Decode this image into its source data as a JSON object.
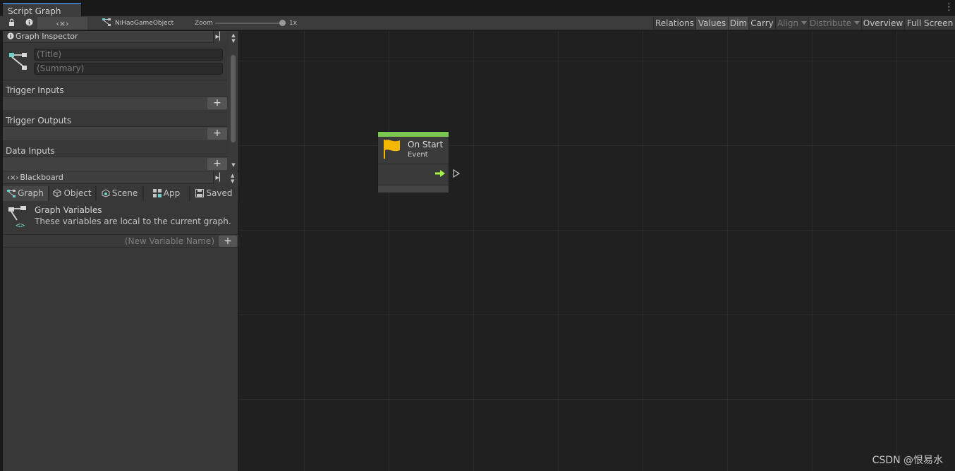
{
  "window": {
    "tab_title": "Script Graph"
  },
  "toolbar": {
    "breadcrumb": "NiHaoGameObject",
    "zoom_label": "Zoom",
    "zoom_value": "1x",
    "zoom_level": 1.0,
    "buttons": {
      "relations": "Relations",
      "values": "Values",
      "dim": "Dim",
      "carry": "Carry",
      "align": "Align",
      "distribute": "Distribute",
      "overview": "Overview",
      "full_screen": "Full Screen"
    }
  },
  "graph_inspector": {
    "header": "Graph Inspector",
    "title_placeholder": "(Title)",
    "summary_placeholder": "(Summary)",
    "sections": {
      "trigger_inputs": "Trigger Inputs",
      "trigger_outputs": "Trigger Outputs",
      "data_inputs": "Data Inputs"
    }
  },
  "blackboard": {
    "header": "Blackboard",
    "tabs": {
      "graph": "Graph",
      "object": "Object",
      "scene": "Scene",
      "app": "App",
      "saved": "Saved"
    },
    "variables_title": "Graph Variables",
    "variables_desc": "These variables are local to the current graph.",
    "new_variable_placeholder": "(New Variable Name)"
  },
  "node": {
    "title": "On Start",
    "subtitle": "Event",
    "accent_color": "#7ac74f"
  },
  "watermark": "CSDN @恨易水"
}
